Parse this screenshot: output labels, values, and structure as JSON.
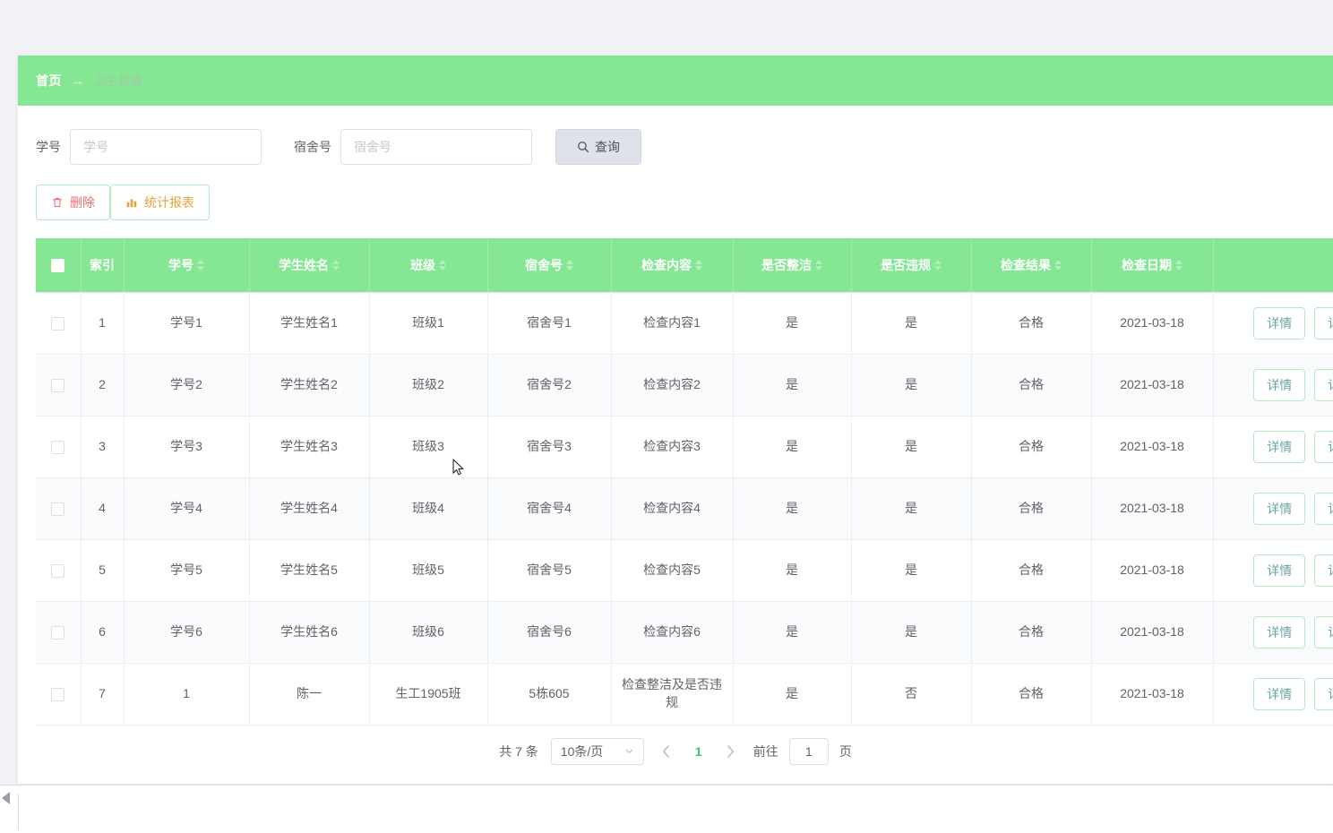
{
  "breadcrumb": {
    "home": "首页",
    "separator": "→",
    "current": "卫生检查"
  },
  "search": {
    "xuehao_label": "学号",
    "xuehao_placeholder": "学号",
    "xuehao_value": "",
    "sushe_label": "宿舍号",
    "sushe_placeholder": "宿舍号",
    "sushe_value": "",
    "query_button": "查询",
    "query_icon": "search-icon"
  },
  "actions": {
    "delete_label": "删除",
    "delete_icon": "trash-icon",
    "delete_color": "#f56c6c",
    "report_label": "统计报表",
    "report_icon": "bar-chart-icon",
    "report_color": "#e6a23c"
  },
  "theme": {
    "header_green": "#85e793",
    "page_bg": "#f0f2f5",
    "border_green": "#b7e9c0",
    "pager_active": "#3dc46b"
  },
  "table": {
    "columns": [
      {
        "key": "checkbox",
        "label": "",
        "sortable": false
      },
      {
        "key": "index",
        "label": "索引",
        "sortable": false
      },
      {
        "key": "xuehao",
        "label": "学号",
        "sortable": true
      },
      {
        "key": "name",
        "label": "学生姓名",
        "sortable": true
      },
      {
        "key": "class",
        "label": "班级",
        "sortable": true
      },
      {
        "key": "dorm",
        "label": "宿舍号",
        "sortable": true
      },
      {
        "key": "content",
        "label": "检查内容",
        "sortable": true
      },
      {
        "key": "tidy",
        "label": "是否整洁",
        "sortable": true
      },
      {
        "key": "violation",
        "label": "是否违规",
        "sortable": true
      },
      {
        "key": "result",
        "label": "检查结果",
        "sortable": true
      },
      {
        "key": "date",
        "label": "检查日期",
        "sortable": true
      },
      {
        "key": "ops",
        "label": "",
        "sortable": false
      }
    ],
    "detail_button": "详情",
    "rows": [
      {
        "index": "1",
        "xuehao": "学号1",
        "name": "学生姓名1",
        "class": "班级1",
        "dorm": "宿舍号1",
        "content": "检查内容1",
        "tidy": "是",
        "violation": "是",
        "result": "合格",
        "date": "2021-03-18"
      },
      {
        "index": "2",
        "xuehao": "学号2",
        "name": "学生姓名2",
        "class": "班级2",
        "dorm": "宿舍号2",
        "content": "检查内容2",
        "tidy": "是",
        "violation": "是",
        "result": "合格",
        "date": "2021-03-18"
      },
      {
        "index": "3",
        "xuehao": "学号3",
        "name": "学生姓名3",
        "class": "班级3",
        "dorm": "宿舍号3",
        "content": "检查内容3",
        "tidy": "是",
        "violation": "是",
        "result": "合格",
        "date": "2021-03-18"
      },
      {
        "index": "4",
        "xuehao": "学号4",
        "name": "学生姓名4",
        "class": "班级4",
        "dorm": "宿舍号4",
        "content": "检查内容4",
        "tidy": "是",
        "violation": "是",
        "result": "合格",
        "date": "2021-03-18"
      },
      {
        "index": "5",
        "xuehao": "学号5",
        "name": "学生姓名5",
        "class": "班级5",
        "dorm": "宿舍号5",
        "content": "检查内容5",
        "tidy": "是",
        "violation": "是",
        "result": "合格",
        "date": "2021-03-18"
      },
      {
        "index": "6",
        "xuehao": "学号6",
        "name": "学生姓名6",
        "class": "班级6",
        "dorm": "宿舍号6",
        "content": "检查内容6",
        "tidy": "是",
        "violation": "是",
        "result": "合格",
        "date": "2021-03-18"
      },
      {
        "index": "7",
        "xuehao": "1",
        "name": "陈一",
        "class": "生工1905班",
        "dorm": "5栋605",
        "content": "检查整洁及是否违规",
        "tidy": "是",
        "violation": "否",
        "result": "合格",
        "date": "2021-03-18"
      }
    ]
  },
  "pagination": {
    "total_text": "共 7 条",
    "page_size": "10条/页",
    "prev_icon": "chevron-left-icon",
    "next_icon": "chevron-right-icon",
    "current_page": "1",
    "jump_prefix": "前往",
    "jump_value": "1",
    "jump_suffix": "页"
  }
}
